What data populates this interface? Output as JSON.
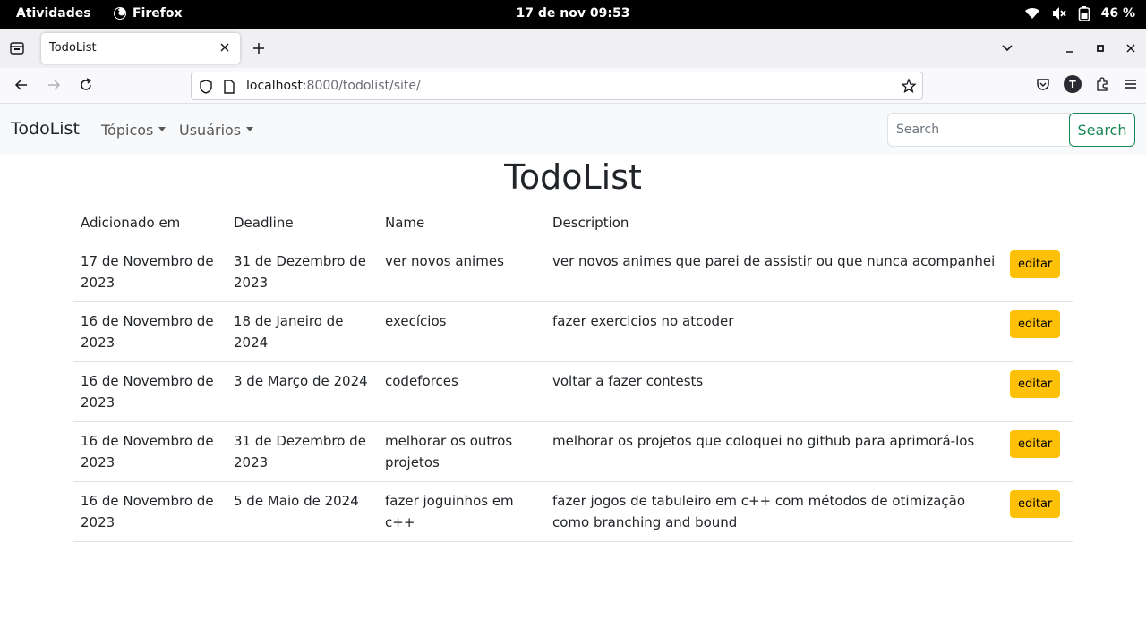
{
  "os": {
    "activities": "Atividades",
    "app_name": "Firefox",
    "clock": "17 de nov  09:53",
    "battery": "46 %"
  },
  "browser": {
    "tab_title": "TodoList",
    "url_host": "localhost",
    "url_rest": ":8000/todolist/site/",
    "account_initial": "T"
  },
  "navbar": {
    "brand": "TodoList",
    "links": [
      "Tópicos",
      "Usuários"
    ],
    "search_placeholder": "Search",
    "search_button": "Search",
    "search_accent": "#198754"
  },
  "page": {
    "title": "TodoList",
    "columns": [
      "Adicionado em",
      "Deadline",
      "Name",
      "Description"
    ],
    "edit_label": "editar",
    "edit_color": "#ffc107",
    "rows": [
      {
        "added": "17 de Novembro de 2023",
        "deadline": "31 de Dezembro de 2023",
        "name": "ver novos animes",
        "description": "ver novos animes que parei de assistir ou que nunca acompanhei"
      },
      {
        "added": "16 de Novembro de 2023",
        "deadline": "18 de Janeiro de 2024",
        "name": "execícios",
        "description": "fazer exercicios no atcoder"
      },
      {
        "added": "16 de Novembro de 2023",
        "deadline": "3 de Março de 2024",
        "name": "codeforces",
        "description": "voltar a fazer contests"
      },
      {
        "added": "16 de Novembro de 2023",
        "deadline": "31 de Dezembro de 2023",
        "name": "melhorar os outros projetos",
        "description": "melhorar os projetos que coloquei no github para aprimorá-los"
      },
      {
        "added": "16 de Novembro de 2023",
        "deadline": "5 de Maio de 2024",
        "name": "fazer joguinhos em c++",
        "description": "fazer jogos de tabuleiro em c++ com métodos de otimização como branching and bound"
      }
    ]
  }
}
